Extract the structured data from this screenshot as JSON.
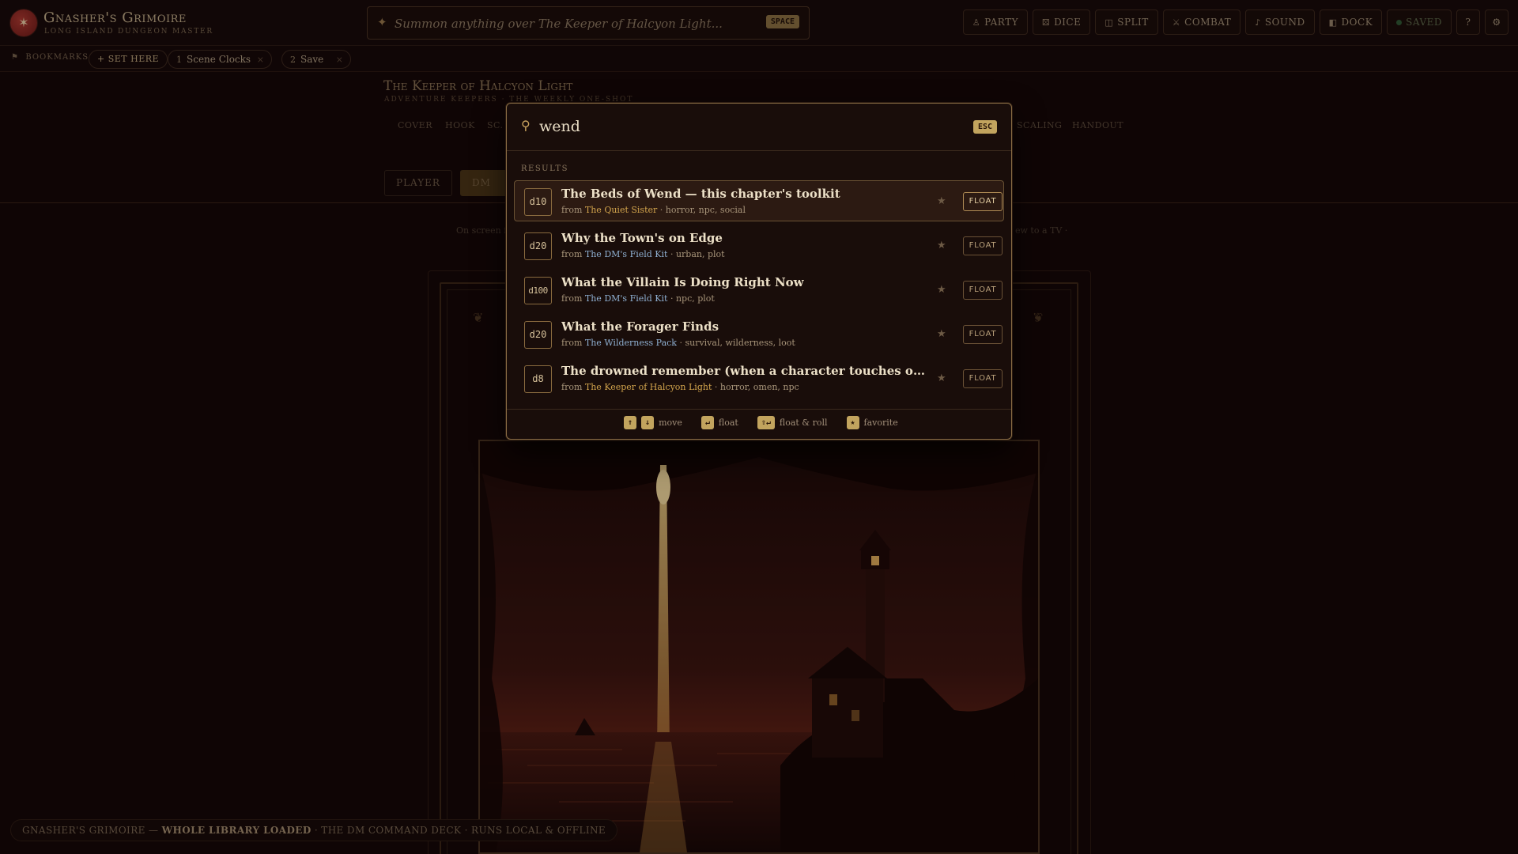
{
  "app": {
    "title": "Gnasher's Grimoire",
    "subtitle": "Long Island Dungeon Master",
    "logo_glyph": "✶"
  },
  "summon": {
    "placeholder": "Summon anything over The Keeper of Halcyon Light...",
    "shortcut": "SPACE"
  },
  "toolbar": {
    "party": "PARTY",
    "dice": "DICE",
    "split": "SPLIT",
    "combat": "COMBAT",
    "sound": "SOUND",
    "dock": "DOCK",
    "saved": "SAVED",
    "help": "?",
    "settings": "⚙"
  },
  "bookmarks": {
    "label": "BOOKMARKS",
    "set_here": "+ SET HERE",
    "items": [
      {
        "num": "1",
        "label": "Scene Clocks"
      },
      {
        "num": "2",
        "label": "Save"
      }
    ]
  },
  "document": {
    "title": "The Keeper of Halcyon Light",
    "subtitle": "Adventure Keepers · The Weekly One-Shot",
    "nav": [
      "COVER",
      "HOOK",
      "SC.",
      "SCALING",
      "HANDOUT"
    ],
    "modes": {
      "player": "PLAYER",
      "dm": "DM TO"
    },
    "hint_left": "On screen fo",
    "hint_right": "ew to a TV ·",
    "flourish": "❦"
  },
  "palette": {
    "query": "wend",
    "esc": "ESC",
    "results_label": "RESULTS",
    "from_prefix": "from",
    "results": [
      {
        "die": "d10",
        "title": "The Beds of Wend — this chapter's toolkit",
        "source": "The Quiet Sister",
        "source_color": "gold",
        "tags": "horror, npc, social",
        "selected": true
      },
      {
        "die": "d20",
        "title": "Why the Town's on Edge",
        "source": "The DM's Field Kit",
        "source_color": "blue",
        "tags": "urban, plot"
      },
      {
        "die": "d100",
        "title": "What the Villain Is Doing Right Now",
        "source": "The DM's Field Kit",
        "source_color": "blue",
        "tags": "npc, plot"
      },
      {
        "die": "d20",
        "title": "What the Forager Finds",
        "source": "The Wilderness Pack",
        "source_color": "blue",
        "tags": "survival, wilderness, loot"
      },
      {
        "die": "d8",
        "title": "The drowned remember (when a character touches one o...",
        "source": "The Keeper of Halcyon Light",
        "source_color": "gold",
        "tags": "horror, omen, npc"
      }
    ],
    "float_label": "FLOAT",
    "footer": {
      "up": "↑",
      "down": "↓",
      "move": "move",
      "enter": "↵",
      "float": "float",
      "shift_enter": "⇧↵",
      "float_roll": "float & roll",
      "star": "★",
      "favorite": "favorite"
    }
  },
  "status": {
    "brand": "GNASHER'S GRIMOIRE — ",
    "loaded": "WHOLE LIBRARY LOADED",
    "rest": " · THE DM COMMAND DECK · RUNS LOCAL & OFFLINE"
  },
  "colors": {
    "background": "#120707",
    "accent_gold": "#c2a45e",
    "palette_border": "#8a6d45",
    "link_blue": "#8fb0d2",
    "link_gold": "#d3a54d"
  }
}
